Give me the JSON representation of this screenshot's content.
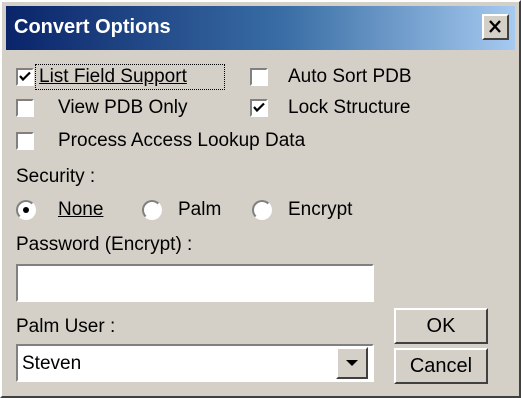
{
  "dialog": {
    "title": "Convert Options"
  },
  "options": {
    "list_field_support": {
      "label": "List Field Support",
      "checked": true
    },
    "auto_sort_pdb": {
      "label": "Auto Sort PDB",
      "checked": false
    },
    "view_pdb_only": {
      "label": "View PDB Only",
      "checked": false
    },
    "lock_structure": {
      "label": "Lock Structure",
      "checked": true
    },
    "process_access_lookup": {
      "label": "Process Access Lookup Data",
      "checked": false
    }
  },
  "security": {
    "label": "Security :",
    "options": [
      {
        "label": "None",
        "selected": true
      },
      {
        "label": "Palm",
        "selected": false
      },
      {
        "label": "Encrypt",
        "selected": false
      }
    ]
  },
  "password": {
    "label": "Password (Encrypt) :",
    "value": ""
  },
  "palm_user": {
    "label": "Palm User :",
    "selected": "Steven"
  },
  "buttons": {
    "ok": "OK",
    "cancel": "Cancel"
  },
  "icons": {
    "close": "close-icon",
    "checkmark": "checkmark-icon",
    "dropdown": "chevron-down-icon"
  }
}
